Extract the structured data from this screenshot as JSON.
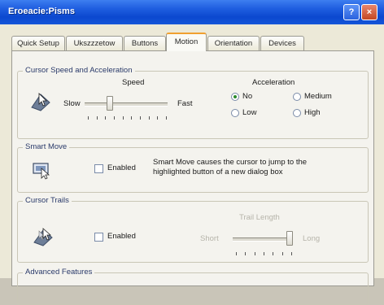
{
  "window": {
    "title": "Eroeacie:Pisms",
    "help_label": "?",
    "close_label": "×"
  },
  "tabs": [
    {
      "label": "Quick Setup",
      "active": false
    },
    {
      "label": "Ukszzzetow",
      "active": false
    },
    {
      "label": "Buttons",
      "active": false
    },
    {
      "label": "Motion",
      "active": true
    },
    {
      "label": "Orientation",
      "active": false
    },
    {
      "label": "Devices",
      "active": false
    }
  ],
  "cursor_speed": {
    "group_label": "Cursor Speed and Acceleration",
    "speed_label": "Speed",
    "slow_label": "Slow",
    "fast_label": "Fast",
    "speed_value": 0.3,
    "acceleration_label": "Acceleration",
    "acceleration_options": [
      "No",
      "Medium",
      "Low",
      "High"
    ],
    "acceleration_selected": "No"
  },
  "smart_move": {
    "group_label": "Smart Move",
    "checkbox_label": "Enabled",
    "checked": false,
    "description": "Smart Move causes the cursor to jump to the highlighted button of a new dialog box"
  },
  "cursor_trails": {
    "group_label": "Cursor Trails",
    "checkbox_label": "Enabled",
    "checked": false,
    "trail_length_label": "Trail Length",
    "short_label": "Short",
    "long_label": "Long",
    "trail_value": 1.0
  },
  "advanced": {
    "group_label": "Advanced Features"
  }
}
